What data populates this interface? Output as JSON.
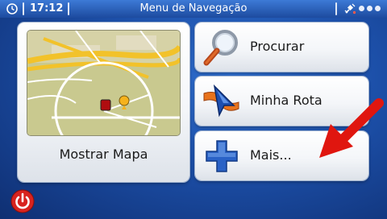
{
  "statusbar": {
    "time": "17:12",
    "title": "Menu de Navegação",
    "icons": [
      "clock-icon",
      "gps-satellite-icon"
    ],
    "page_indicator_count": 3
  },
  "map_tile": {
    "label": "Mostrar Mapa"
  },
  "menu": [
    {
      "label": "Procurar",
      "icon": "magnifier-icon"
    },
    {
      "label": "Minha Rota",
      "icon": "route-arrow-icon"
    },
    {
      "label": "Mais...",
      "icon": "plus-icon"
    }
  ],
  "colors": {
    "background": "#1c4fa8",
    "statusbar": "#2d63bd",
    "power": "#d8231f",
    "arrow": "#e0160f",
    "map_road": "#f2c22a"
  }
}
